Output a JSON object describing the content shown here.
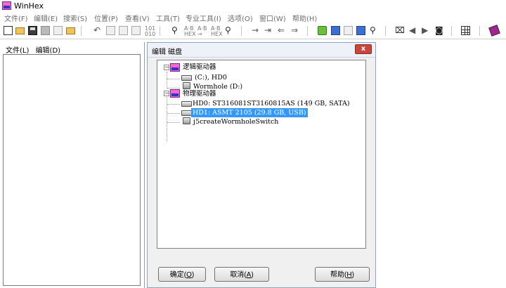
{
  "window": {
    "title": "WinHex"
  },
  "menu": [
    "文件(F)",
    "编辑(E)",
    "搜索(S)",
    "位置(P)",
    "查看(V)",
    "工具(T)",
    "专业工具(I)",
    "选项(O)",
    "窗口(W)",
    "帮助(H)"
  ],
  "left_panel": {
    "tabs": [
      "文件(L)",
      "编辑(D)"
    ]
  },
  "dialog": {
    "title": "编辑 磁盘",
    "close_label": "x",
    "tree": [
      {
        "label": "逻辑驱动器",
        "icon": "hex-icon",
        "expander": "−"
      },
      {
        "label": "(C:), HD0",
        "icon": "drive-icon"
      },
      {
        "label": "Wormhole (D:)",
        "icon": "usb-drive-icon"
      },
      {
        "label": "物理驱动器",
        "icon": "hex-icon",
        "expander": "−"
      },
      {
        "label": "HD0: ST316081ST3160815AS (149 GB, SATA)",
        "icon": "drive-icon"
      },
      {
        "label": "HD1: ASMT    2105 (29.8 GB, USB)",
        "icon": "drive-icon",
        "selected": true
      },
      {
        "label": "j5createWormholeSwitch",
        "icon": "usb-drive-icon"
      }
    ],
    "buttons": {
      "ok": {
        "text": "确定(",
        "key": "O",
        "end": ")"
      },
      "cancel": {
        "text": "取消(",
        "key": "A",
        "end": ")"
      },
      "help": {
        "text": "帮助(",
        "key": "H",
        "end": ")"
      }
    }
  },
  "colors": {
    "selection": "#3399ff",
    "close_button": "#c9463d"
  }
}
